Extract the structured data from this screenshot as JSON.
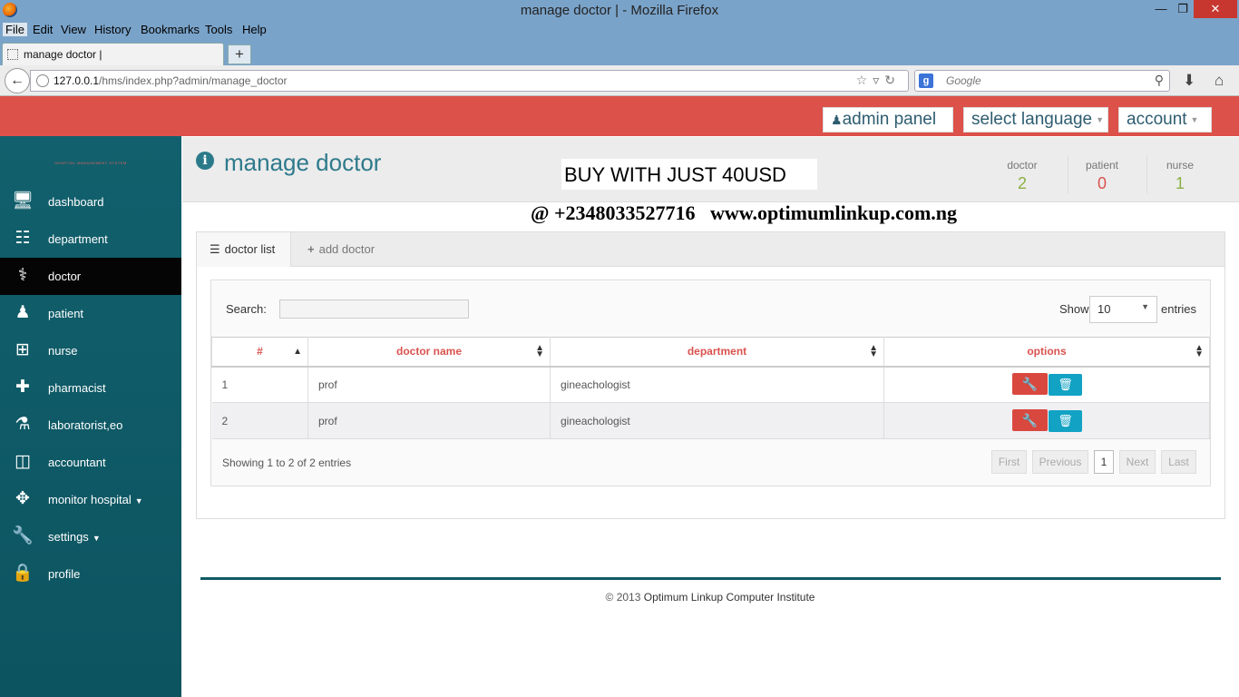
{
  "browser": {
    "window_title": "manage doctor | - Mozilla Firefox",
    "menu": [
      "File",
      "Edit",
      "View",
      "History",
      "Bookmarks",
      "Tools",
      "Help"
    ],
    "tab_title": "manage doctor |",
    "url_host": "127.0.0.1",
    "url_path": "/hms/index.php?admin/manage_doctor",
    "search_placeholder": "Google"
  },
  "header": {
    "admin_panel": "admin panel",
    "language": "select language",
    "account": "account"
  },
  "sidebar": {
    "brand": "hospital management system",
    "items": [
      {
        "label": "dashboard",
        "icon": "monitor-icon"
      },
      {
        "label": "department",
        "icon": "sitemap-icon"
      },
      {
        "label": "doctor",
        "icon": "doctor-icon",
        "active": true
      },
      {
        "label": "patient",
        "icon": "user-icon"
      },
      {
        "label": "nurse",
        "icon": "plus-square-icon"
      },
      {
        "label": "pharmacist",
        "icon": "medkit-icon"
      },
      {
        "label": "laboratorist,eo",
        "icon": "flask-icon"
      },
      {
        "label": "accountant",
        "icon": "money-icon"
      },
      {
        "label": "monitor hospital",
        "icon": "move-icon",
        "dropdown": true
      },
      {
        "label": "settings",
        "icon": "wrench-icon",
        "dropdown": true
      },
      {
        "label": "profile",
        "icon": "lock-icon"
      }
    ]
  },
  "page": {
    "title": "manage doctor",
    "promo_line1": "BUY WITH JUST 40USD",
    "promo_line2": "@ +2348033527716   www.optimumlinkup.com.ng",
    "stats": [
      {
        "label": "doctor",
        "value": "2",
        "color": "#8cb044"
      },
      {
        "label": "patient",
        "value": "0",
        "color": "#d9534f"
      },
      {
        "label": "nurse",
        "value": "1",
        "color": "#8cb044"
      }
    ]
  },
  "panel": {
    "tab_list": "doctor list",
    "tab_add": "add doctor",
    "search_label": "Search:",
    "search_value": "",
    "show_label": "Show",
    "show_value": "10",
    "entries_label": "entries",
    "columns": [
      "#",
      "doctor name",
      "department",
      "options"
    ],
    "rows": [
      {
        "num": "1",
        "name": "prof",
        "department": "gineachologist"
      },
      {
        "num": "2",
        "name": "prof",
        "department": "gineachologist"
      }
    ],
    "info": "Showing 1 to 2 of 2 entries",
    "pagination": {
      "first": "First",
      "previous": "Previous",
      "current": "1",
      "next": "Next",
      "last": "Last"
    }
  },
  "footer": {
    "copyright": "© 2013",
    "company": "Optimum Linkup Computer Institute"
  }
}
